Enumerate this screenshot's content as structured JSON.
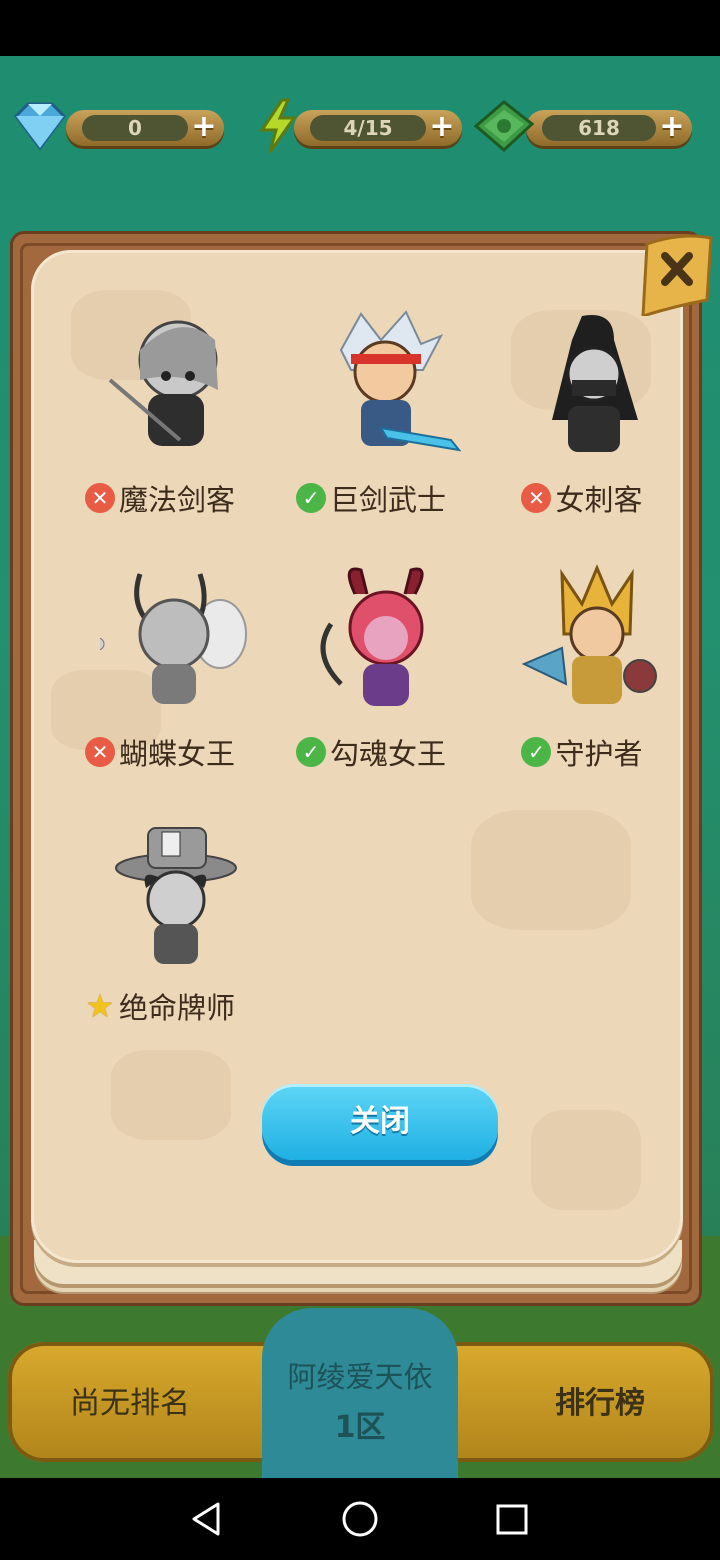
{
  "resources": {
    "gems": {
      "value": "0",
      "icon": "diamond-icon"
    },
    "energy": {
      "value": "4/15",
      "icon": "lightning-icon"
    },
    "cash": {
      "value": "618",
      "icon": "cash-icon"
    }
  },
  "heroes": [
    {
      "name": "魔法剑客",
      "status": "locked",
      "badge": "✕",
      "portrait": "magic-swordsman"
    },
    {
      "name": "巨剑武士",
      "status": "owned",
      "badge": "✓",
      "portrait": "greatsword-warrior"
    },
    {
      "name": "女刺客",
      "status": "locked",
      "badge": "✕",
      "portrait": "female-assassin"
    },
    {
      "name": "蝴蝶女王",
      "status": "locked",
      "badge": "✕",
      "portrait": "butterfly-queen"
    },
    {
      "name": "勾魂女王",
      "status": "owned",
      "badge": "✓",
      "portrait": "soul-queen"
    },
    {
      "name": "守护者",
      "status": "owned",
      "badge": "✓",
      "portrait": "guardian"
    },
    {
      "name": "绝命牌师",
      "status": "current",
      "badge": "★",
      "portrait": "card-master"
    }
  ],
  "close_button": {
    "label": "关闭"
  },
  "bottom_bar": {
    "rank_label": "尚无排名",
    "server_name": "阿绫爱天依",
    "server_zone": "1区",
    "leaderboard_label": "排行榜"
  }
}
